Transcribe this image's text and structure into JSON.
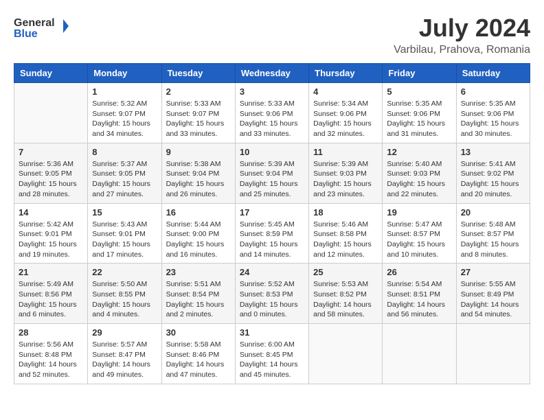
{
  "header": {
    "logo_line1": "General",
    "logo_line2": "Blue",
    "month_year": "July 2024",
    "location": "Varbilau, Prahova, Romania"
  },
  "calendar": {
    "days_of_week": [
      "Sunday",
      "Monday",
      "Tuesday",
      "Wednesday",
      "Thursday",
      "Friday",
      "Saturday"
    ],
    "weeks": [
      [
        {
          "day": "",
          "info": ""
        },
        {
          "day": "1",
          "info": "Sunrise: 5:32 AM\nSunset: 9:07 PM\nDaylight: 15 hours\nand 34 minutes."
        },
        {
          "day": "2",
          "info": "Sunrise: 5:33 AM\nSunset: 9:07 PM\nDaylight: 15 hours\nand 33 minutes."
        },
        {
          "day": "3",
          "info": "Sunrise: 5:33 AM\nSunset: 9:06 PM\nDaylight: 15 hours\nand 33 minutes."
        },
        {
          "day": "4",
          "info": "Sunrise: 5:34 AM\nSunset: 9:06 PM\nDaylight: 15 hours\nand 32 minutes."
        },
        {
          "day": "5",
          "info": "Sunrise: 5:35 AM\nSunset: 9:06 PM\nDaylight: 15 hours\nand 31 minutes."
        },
        {
          "day": "6",
          "info": "Sunrise: 5:35 AM\nSunset: 9:06 PM\nDaylight: 15 hours\nand 30 minutes."
        }
      ],
      [
        {
          "day": "7",
          "info": "Sunrise: 5:36 AM\nSunset: 9:05 PM\nDaylight: 15 hours\nand 28 minutes."
        },
        {
          "day": "8",
          "info": "Sunrise: 5:37 AM\nSunset: 9:05 PM\nDaylight: 15 hours\nand 27 minutes."
        },
        {
          "day": "9",
          "info": "Sunrise: 5:38 AM\nSunset: 9:04 PM\nDaylight: 15 hours\nand 26 minutes."
        },
        {
          "day": "10",
          "info": "Sunrise: 5:39 AM\nSunset: 9:04 PM\nDaylight: 15 hours\nand 25 minutes."
        },
        {
          "day": "11",
          "info": "Sunrise: 5:39 AM\nSunset: 9:03 PM\nDaylight: 15 hours\nand 23 minutes."
        },
        {
          "day": "12",
          "info": "Sunrise: 5:40 AM\nSunset: 9:03 PM\nDaylight: 15 hours\nand 22 minutes."
        },
        {
          "day": "13",
          "info": "Sunrise: 5:41 AM\nSunset: 9:02 PM\nDaylight: 15 hours\nand 20 minutes."
        }
      ],
      [
        {
          "day": "14",
          "info": "Sunrise: 5:42 AM\nSunset: 9:01 PM\nDaylight: 15 hours\nand 19 minutes."
        },
        {
          "day": "15",
          "info": "Sunrise: 5:43 AM\nSunset: 9:01 PM\nDaylight: 15 hours\nand 17 minutes."
        },
        {
          "day": "16",
          "info": "Sunrise: 5:44 AM\nSunset: 9:00 PM\nDaylight: 15 hours\nand 16 minutes."
        },
        {
          "day": "17",
          "info": "Sunrise: 5:45 AM\nSunset: 8:59 PM\nDaylight: 15 hours\nand 14 minutes."
        },
        {
          "day": "18",
          "info": "Sunrise: 5:46 AM\nSunset: 8:58 PM\nDaylight: 15 hours\nand 12 minutes."
        },
        {
          "day": "19",
          "info": "Sunrise: 5:47 AM\nSunset: 8:57 PM\nDaylight: 15 hours\nand 10 minutes."
        },
        {
          "day": "20",
          "info": "Sunrise: 5:48 AM\nSunset: 8:57 PM\nDaylight: 15 hours\nand 8 minutes."
        }
      ],
      [
        {
          "day": "21",
          "info": "Sunrise: 5:49 AM\nSunset: 8:56 PM\nDaylight: 15 hours\nand 6 minutes."
        },
        {
          "day": "22",
          "info": "Sunrise: 5:50 AM\nSunset: 8:55 PM\nDaylight: 15 hours\nand 4 minutes."
        },
        {
          "day": "23",
          "info": "Sunrise: 5:51 AM\nSunset: 8:54 PM\nDaylight: 15 hours\nand 2 minutes."
        },
        {
          "day": "24",
          "info": "Sunrise: 5:52 AM\nSunset: 8:53 PM\nDaylight: 15 hours\nand 0 minutes."
        },
        {
          "day": "25",
          "info": "Sunrise: 5:53 AM\nSunset: 8:52 PM\nDaylight: 14 hours\nand 58 minutes."
        },
        {
          "day": "26",
          "info": "Sunrise: 5:54 AM\nSunset: 8:51 PM\nDaylight: 14 hours\nand 56 minutes."
        },
        {
          "day": "27",
          "info": "Sunrise: 5:55 AM\nSunset: 8:49 PM\nDaylight: 14 hours\nand 54 minutes."
        }
      ],
      [
        {
          "day": "28",
          "info": "Sunrise: 5:56 AM\nSunset: 8:48 PM\nDaylight: 14 hours\nand 52 minutes."
        },
        {
          "day": "29",
          "info": "Sunrise: 5:57 AM\nSunset: 8:47 PM\nDaylight: 14 hours\nand 49 minutes."
        },
        {
          "day": "30",
          "info": "Sunrise: 5:58 AM\nSunset: 8:46 PM\nDaylight: 14 hours\nand 47 minutes."
        },
        {
          "day": "31",
          "info": "Sunrise: 6:00 AM\nSunset: 8:45 PM\nDaylight: 14 hours\nand 45 minutes."
        },
        {
          "day": "",
          "info": ""
        },
        {
          "day": "",
          "info": ""
        },
        {
          "day": "",
          "info": ""
        }
      ]
    ]
  }
}
